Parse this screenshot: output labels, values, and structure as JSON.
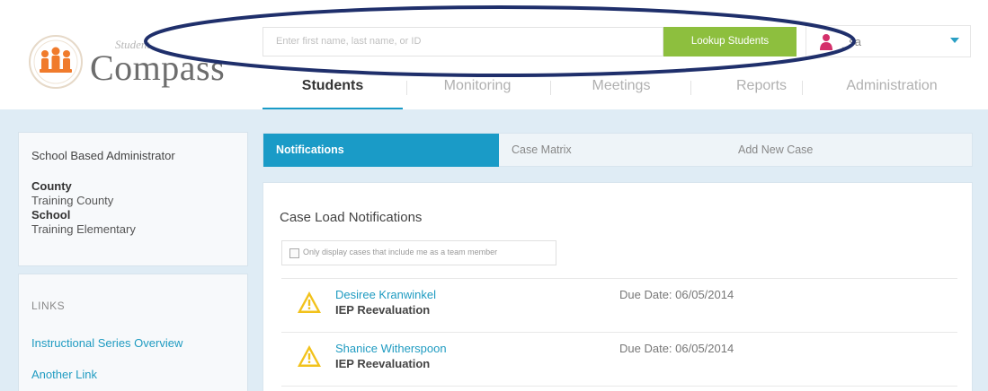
{
  "app": {
    "logo_small": "Student",
    "logo_name": "Compass"
  },
  "search": {
    "placeholder": "Enter first name, last name, or ID",
    "button_label": "Lookup Students"
  },
  "user": {
    "name": "_sa"
  },
  "nav": {
    "tabs": [
      {
        "label": "Students",
        "active": true
      },
      {
        "label": "Monitoring",
        "active": false
      },
      {
        "label": "Meetings",
        "active": false
      },
      {
        "label": "Reports",
        "active": false
      },
      {
        "label": "Administration",
        "active": false
      }
    ]
  },
  "sidebar": {
    "role": "School Based Administrator",
    "county_label": "County",
    "county_value": "Training County",
    "school_label": "School",
    "school_value": "Training Elementary",
    "links_title": "LINKS",
    "links": [
      {
        "label": "Instructional Series Overview"
      },
      {
        "label": "Another Link"
      }
    ]
  },
  "main": {
    "tabs": [
      {
        "label": "Notifications",
        "active": true
      },
      {
        "label": "Case Matrix",
        "active": false
      },
      {
        "label": "Add New Case",
        "active": false
      }
    ],
    "title": "Case Load Notifications",
    "filter_label": "Only display cases that include me as a team member",
    "notifications": [
      {
        "name": "Desiree Kranwinkel",
        "type": "IEP Reevaluation",
        "due": "Due Date: 06/05/2014"
      },
      {
        "name": "Shanice Witherspoon",
        "type": "IEP Reevaluation",
        "due": "Due Date: 06/05/2014"
      }
    ]
  },
  "colors": {
    "accent": "#1a9bc7",
    "lookup_button": "#8dbf3e",
    "band": "#dfecf5",
    "warning": "#f2c21b",
    "annotation_ellipse": "#1f2f6b"
  },
  "icons": [
    "compass-seal-logo",
    "user-icon",
    "chevron-down-icon",
    "warning-icon",
    "checkbox-icon"
  ]
}
